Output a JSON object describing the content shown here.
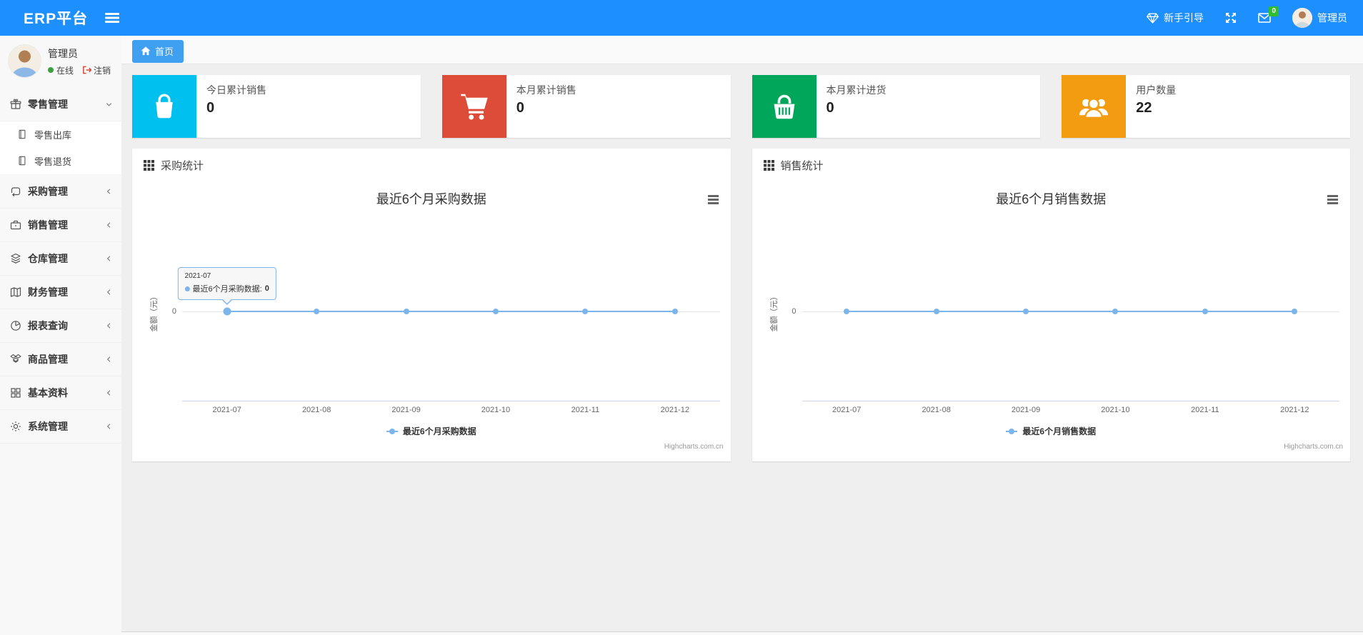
{
  "navbar": {
    "brand": "ERP平台",
    "guide_label": "新手引导",
    "message_badge": "0",
    "username": "管理员",
    "icons": [
      "hamburger-icon",
      "gem-icon",
      "fullscreen-icon",
      "envelope-icon",
      "avatar"
    ]
  },
  "sidebar": {
    "user": {
      "name": "管理员",
      "status": "在线",
      "logout": "注销"
    },
    "items": [
      {
        "label": "零售管理",
        "icon": "gift-icon",
        "state": "expanded",
        "children": [
          {
            "label": "零售出库",
            "icon": "document-icon"
          },
          {
            "label": "零售退货",
            "icon": "document-icon"
          }
        ]
      },
      {
        "label": "采购管理",
        "icon": "repeat-icon",
        "state": "collapsed"
      },
      {
        "label": "销售管理",
        "icon": "briefcase-icon",
        "state": "collapsed"
      },
      {
        "label": "仓库管理",
        "icon": "layers-icon",
        "state": "collapsed"
      },
      {
        "label": "财务管理",
        "icon": "book-icon",
        "state": "collapsed"
      },
      {
        "label": "报表查询",
        "icon": "pie-chart-icon",
        "state": "collapsed"
      },
      {
        "label": "商品管理",
        "icon": "dropbox-icon",
        "state": "collapsed"
      },
      {
        "label": "基本资料",
        "icon": "grid-icon",
        "state": "collapsed"
      },
      {
        "label": "系统管理",
        "icon": "gear-icon",
        "state": "collapsed"
      }
    ]
  },
  "tabs": [
    {
      "label": "首页",
      "icon": "home-icon",
      "active": true
    }
  ],
  "cards": [
    {
      "label": "今日累计销售",
      "value": "0",
      "color": "#00c0ef",
      "icon": "shopping-bag-icon"
    },
    {
      "label": "本月累计销售",
      "value": "0",
      "color": "#dd4b39",
      "icon": "shopping-cart-icon"
    },
    {
      "label": "本月累计进货",
      "value": "0",
      "color": "#00a65a",
      "icon": "shopping-basket-icon"
    },
    {
      "label": "用户数量",
      "value": "22",
      "color": "#f39c12",
      "icon": "users-icon"
    }
  ],
  "panels": [
    {
      "header": "采购统计",
      "icon": "th-grid-icon"
    },
    {
      "header": "销售统计",
      "icon": "th-grid-icon"
    }
  ],
  "chart_data": [
    {
      "type": "line",
      "title": "最近6个月采购数据",
      "categories": [
        "2021-07",
        "2021-08",
        "2021-09",
        "2021-10",
        "2021-11",
        "2021-12"
      ],
      "series": [
        {
          "name": "最近6个月采购数据",
          "values": [
            0,
            0,
            0,
            0,
            0,
            0
          ]
        }
      ],
      "xlabel": "",
      "ylabel": "金额（元）",
      "yticks": [
        "0"
      ],
      "ylim": [
        -1,
        1
      ],
      "grid": true,
      "legend_position": "bottom",
      "line_color": "#7cb5ec",
      "credits": "Highcharts.com.cn",
      "tooltip": {
        "header": "2021-07",
        "series": "最近6个月采购数据",
        "value": "0",
        "point_index": 0
      }
    },
    {
      "type": "line",
      "title": "最近6个月销售数据",
      "categories": [
        "2021-07",
        "2021-08",
        "2021-09",
        "2021-10",
        "2021-11",
        "2021-12"
      ],
      "series": [
        {
          "name": "最近6个月销售数据",
          "values": [
            0,
            0,
            0,
            0,
            0,
            0
          ]
        }
      ],
      "xlabel": "",
      "ylabel": "金额（元）",
      "yticks": [
        "0"
      ],
      "ylim": [
        -1,
        1
      ],
      "grid": true,
      "legend_position": "bottom",
      "line_color": "#7cb5ec",
      "credits": "Highcharts.com.cn",
      "tooltip": null
    }
  ],
  "colors": {
    "navbar": "#1e8fff",
    "tab_active": "#3f9ff0",
    "chart_line": "#7cb5ec",
    "message_badge_bg": "#2fbe2f",
    "online_dot": "#3c9f40",
    "logout_icon": "#dd4b39"
  }
}
